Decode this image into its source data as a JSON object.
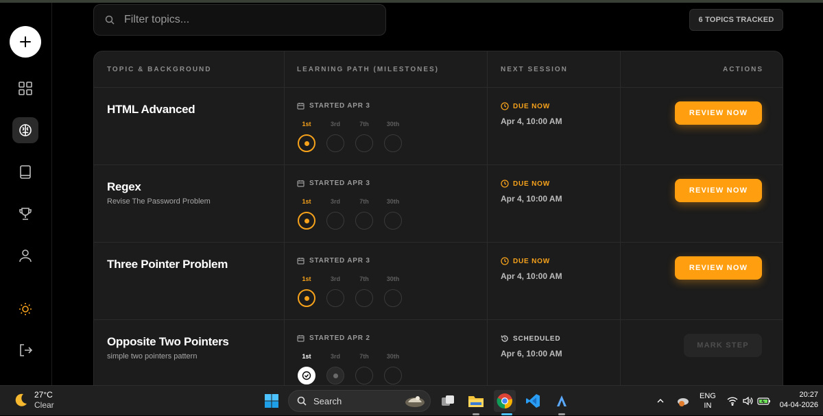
{
  "search": {
    "placeholder": "Filter topics..."
  },
  "badge": "6 TOPICS TRACKED",
  "columns": {
    "topic": "TOPIC & BACKGROUND",
    "path": "LEARNING PATH (MILESTONES)",
    "next": "NEXT SESSION",
    "actions": "ACTIONS"
  },
  "milestone_labels": [
    "1st",
    "3rd",
    "7th",
    "30th"
  ],
  "rows": [
    {
      "title": "HTML Advanced",
      "subtitle": "",
      "started": "STARTED APR 3",
      "status": "DUE NOW",
      "when": "Apr 4, 10:00 AM",
      "action": "REVIEW NOW",
      "progress": "0 of 4 milestones done, 1st current"
    },
    {
      "title": "Regex",
      "subtitle": "Revise The Password Problem",
      "started": "STARTED APR 3",
      "status": "DUE NOW",
      "when": "Apr 4, 10:00 AM",
      "action": "REVIEW NOW",
      "progress": "0 of 4 milestones done, 1st current"
    },
    {
      "title": "Three Pointer Problem",
      "subtitle": "",
      "started": "STARTED APR 3",
      "status": "DUE NOW",
      "when": "Apr 4, 10:00 AM",
      "action": "REVIEW NOW",
      "progress": "0 of 4 milestones done, 1st current"
    },
    {
      "title": "Opposite Two Pointers",
      "subtitle": "simple two pointers pattern",
      "started": "STARTED APR 2",
      "status": "SCHEDULED",
      "when": "Apr 6, 10:00 AM",
      "action": "MARK STEP",
      "progress": "1 of 4 milestones done, 3rd next"
    }
  ],
  "colors": {
    "accent": "#ff9e0f",
    "background": "#000000",
    "card": "#1c1c1c"
  },
  "taskbar": {
    "temp": "27°C",
    "condition": "Clear",
    "search_label": "Search",
    "lang1": "ENG",
    "lang2": "IN",
    "time": "20:27",
    "date": "04-04-2026"
  }
}
